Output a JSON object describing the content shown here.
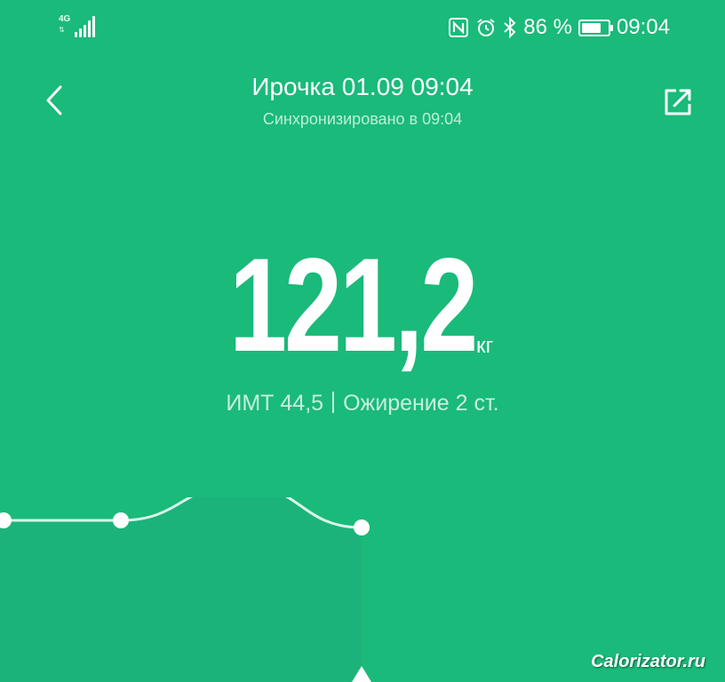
{
  "status_bar": {
    "network": "4G",
    "battery_percent": "86 %",
    "battery_level": 0.86,
    "time": "09:04",
    "icons": [
      "signal-icon",
      "nfc-icon",
      "alarm-icon",
      "bluetooth-icon",
      "battery-icon"
    ]
  },
  "header": {
    "title": "Ирочка 01.09 09:04",
    "subtitle": "Синхронизировано в 09:04",
    "back_icon": "chevron-left-icon",
    "share_icon": "share-icon"
  },
  "measurement": {
    "weight": "121,2",
    "unit": "кг",
    "bmi": "ИМТ 44,5",
    "category": "Ожирение 2 ст."
  },
  "chart_data": {
    "type": "line",
    "x": [
      0,
      1,
      2,
      3
    ],
    "values": [
      121.3,
      121.3,
      121.8,
      121.2
    ],
    "title": "",
    "xlabel": "",
    "ylabel": ""
  },
  "watermark": "Calorizator.ru"
}
